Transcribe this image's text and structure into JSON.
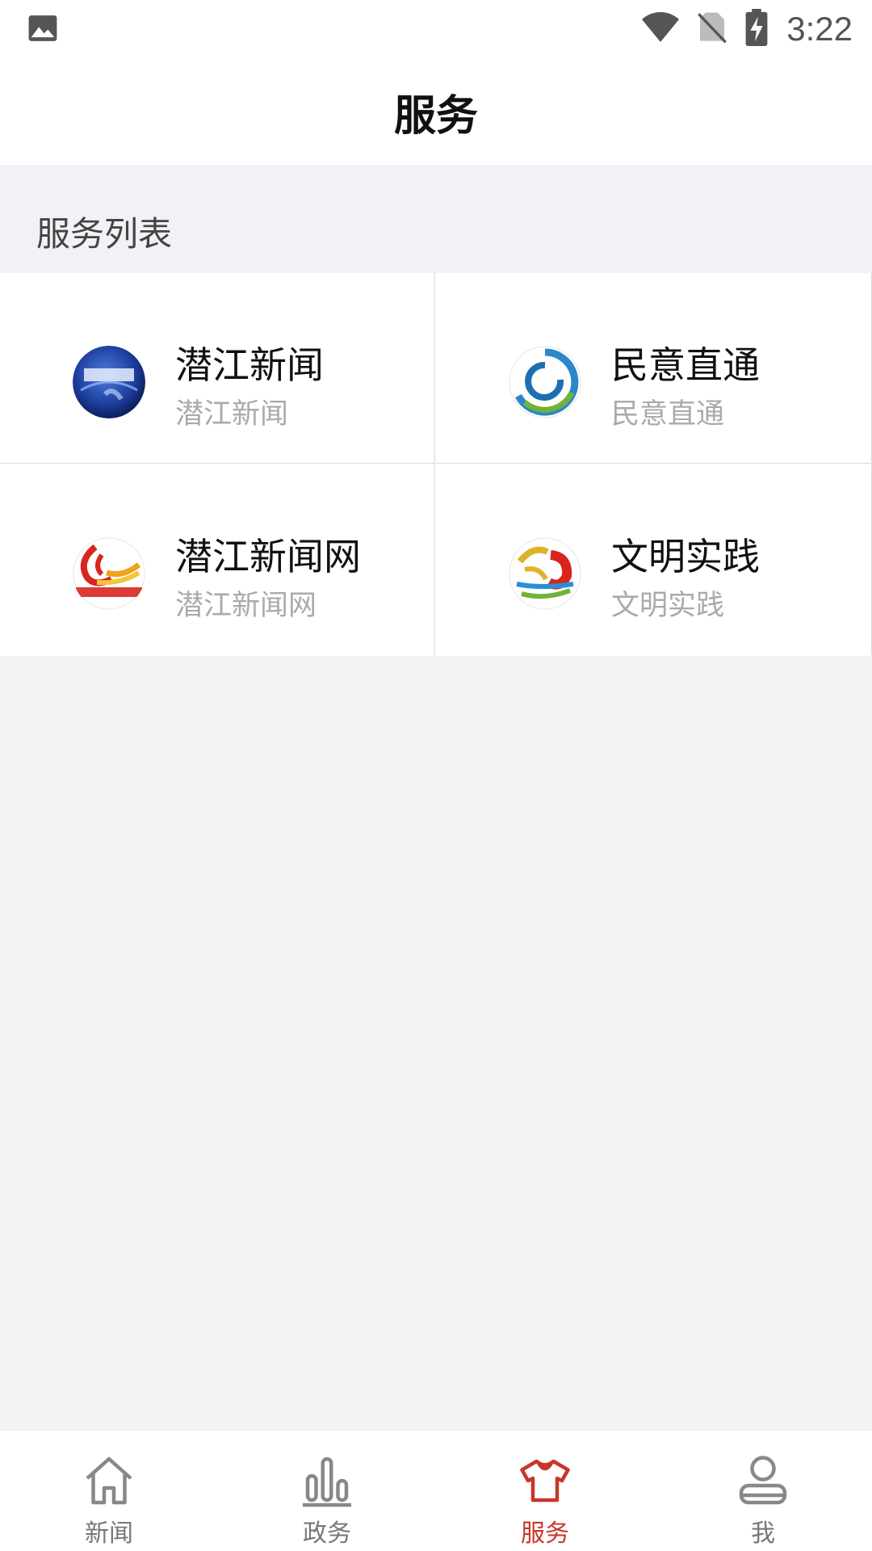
{
  "status_bar": {
    "time": "3:22",
    "icons": [
      "image-icon",
      "wifi-icon",
      "no-sim-icon",
      "battery-charging-icon"
    ]
  },
  "header": {
    "title": "服务"
  },
  "section": {
    "title": "服务列表"
  },
  "services": [
    {
      "title": "潜江新闻",
      "subtitle": "潜江新闻",
      "icon": "qianjiang-news-logo"
    },
    {
      "title": "民意直通",
      "subtitle": "民意直通",
      "icon": "public-opinion-logo"
    },
    {
      "title": "潜江新闻网",
      "subtitle": "潜江新闻网",
      "icon": "qianjiang-news-web-logo"
    },
    {
      "title": "文明实践",
      "subtitle": "文明实践",
      "icon": "civilization-practice-logo"
    }
  ],
  "bottom_nav": {
    "items": [
      {
        "label": "新闻",
        "icon": "home-icon"
      },
      {
        "label": "政务",
        "icon": "bar-chart-icon"
      },
      {
        "label": "服务",
        "icon": "shirt-icon",
        "active": true
      },
      {
        "label": "我",
        "icon": "person-icon"
      }
    ]
  },
  "colors": {
    "accent": "#c9352a",
    "background": "#f3f3f5"
  }
}
